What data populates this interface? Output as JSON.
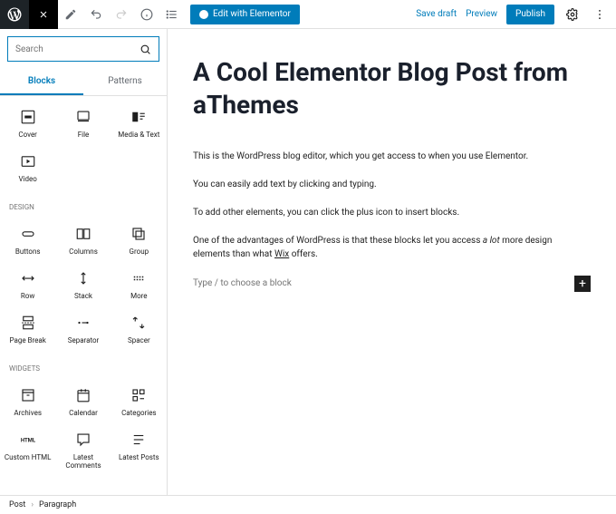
{
  "top": {
    "editWithElementor": "Edit with Elementor",
    "saveDraft": "Save draft",
    "preview": "Preview",
    "publish": "Publish"
  },
  "sidebar": {
    "searchPlaceholder": "Search",
    "tabs": {
      "blocks": "Blocks",
      "patterns": "Patterns"
    },
    "mediaBlocks": [
      {
        "label": "Cover",
        "icon": "cover"
      },
      {
        "label": "File",
        "icon": "file"
      },
      {
        "label": "Media & Text",
        "icon": "media-text"
      },
      {
        "label": "Video",
        "icon": "video"
      }
    ],
    "sections": [
      {
        "title": "DESIGN",
        "blocks": [
          {
            "label": "Buttons",
            "icon": "buttons"
          },
          {
            "label": "Columns",
            "icon": "columns"
          },
          {
            "label": "Group",
            "icon": "group"
          },
          {
            "label": "Row",
            "icon": "row"
          },
          {
            "label": "Stack",
            "icon": "stack"
          },
          {
            "label": "More",
            "icon": "more"
          },
          {
            "label": "Page Break",
            "icon": "page-break"
          },
          {
            "label": "Separator",
            "icon": "separator"
          },
          {
            "label": "Spacer",
            "icon": "spacer"
          }
        ]
      },
      {
        "title": "WIDGETS",
        "blocks": [
          {
            "label": "Archives",
            "icon": "archives"
          },
          {
            "label": "Calendar",
            "icon": "calendar"
          },
          {
            "label": "Categories",
            "icon": "categories"
          },
          {
            "label": "Custom HTML",
            "icon": "html"
          },
          {
            "label": "Latest Comments",
            "icon": "comments"
          },
          {
            "label": "Latest Posts",
            "icon": "posts"
          }
        ]
      }
    ]
  },
  "content": {
    "title": "A Cool Elementor Blog Post from aThemes",
    "p1": "This is the WordPress blog editor, which you get access to when you use Elementor.",
    "p2": "You can easily add text by clicking and typing.",
    "p3": "To add other elements, you can click the plus icon to insert blocks.",
    "p4a": "One of the advantages of WordPress is that these blocks let you access ",
    "p4b": "a lot",
    "p4c": " more design elements than what ",
    "p4d": "Wix",
    "p4e": " offers.",
    "placeholder": "Type / to choose a block"
  },
  "breadcrumb": {
    "root": "Post",
    "current": "Paragraph"
  }
}
